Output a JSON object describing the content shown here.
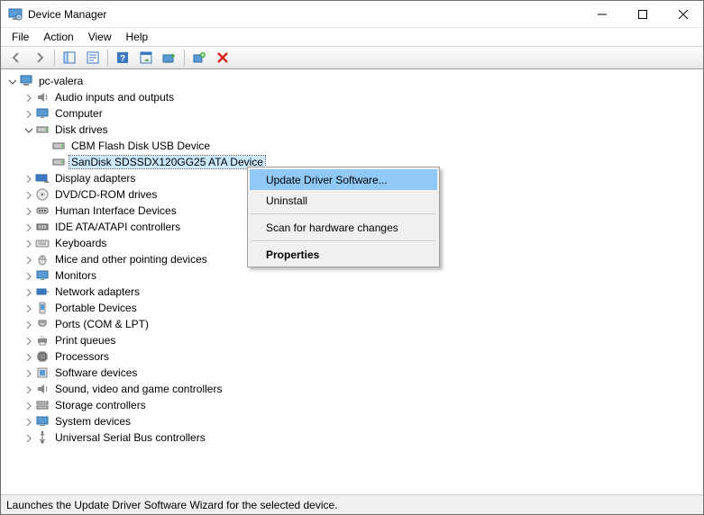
{
  "window": {
    "title": "Device Manager"
  },
  "menubar": {
    "file": "File",
    "action": "Action",
    "view": "View",
    "help": "Help"
  },
  "tree": {
    "root": "pc-valera",
    "nodes": {
      "audio": "Audio inputs and outputs",
      "computer": "Computer",
      "disk": "Disk drives",
      "disk_cbm": "CBM Flash Disk USB Device",
      "disk_sandisk": "SanDisk SDSSDX120GG25 ATA Device",
      "display": "Display adapters",
      "dvd": "DVD/CD-ROM drives",
      "hid": "Human Interface Devices",
      "ide": "IDE ATA/ATAPI controllers",
      "keyboards": "Keyboards",
      "mice": "Mice and other pointing devices",
      "monitors": "Monitors",
      "network": "Network adapters",
      "portable": "Portable Devices",
      "ports": "Ports (COM & LPT)",
      "print": "Print queues",
      "processors": "Processors",
      "software": "Software devices",
      "sound": "Sound, video and game controllers",
      "storage": "Storage controllers",
      "system": "System devices",
      "usb": "Universal Serial Bus controllers"
    }
  },
  "context_menu": {
    "update": "Update Driver Software...",
    "uninstall": "Uninstall",
    "scan": "Scan for hardware changes",
    "properties": "Properties"
  },
  "statusbar": {
    "text": "Launches the Update Driver Software Wizard for the selected device."
  }
}
